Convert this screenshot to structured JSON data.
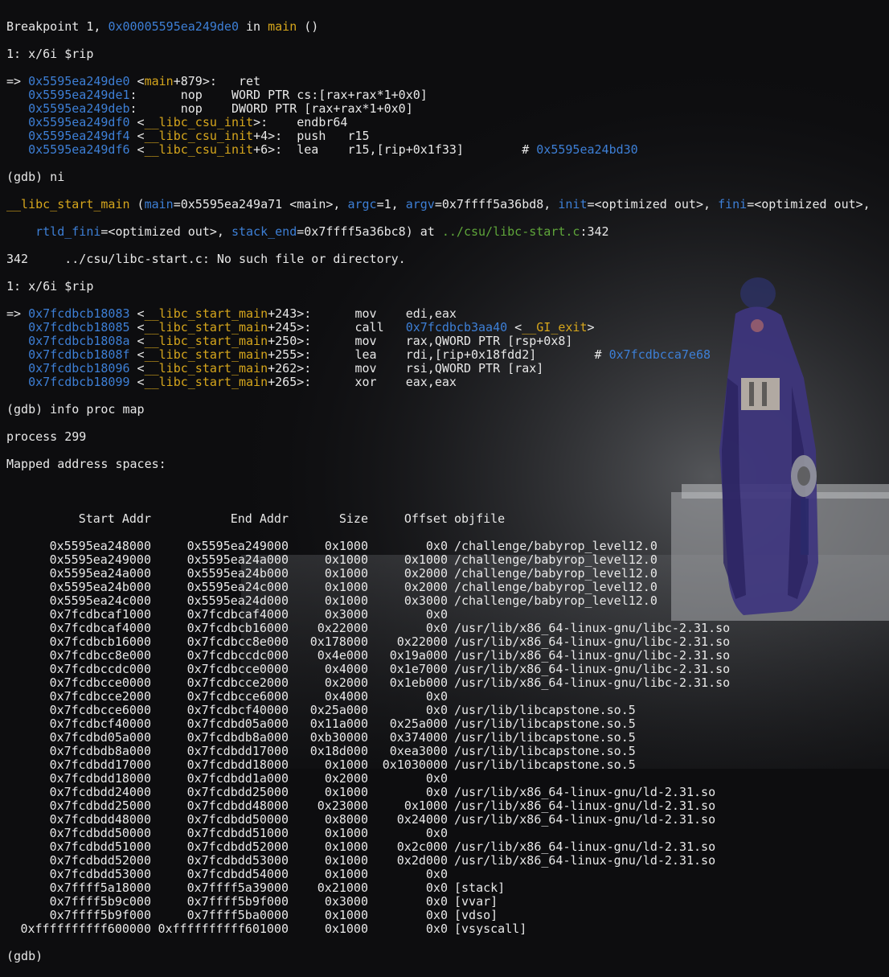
{
  "terminal": {
    "breakpoint": {
      "prefix": "Breakpoint 1, ",
      "address": "0x00005595ea249de0",
      "mid": " in ",
      "func": "main",
      "suffix": " ()"
    },
    "disp1_header": "1: x/6i $rip",
    "block1": [
      {
        "marker": "=> ",
        "addr": "0x5595ea249de0",
        "sym": "main",
        "off": "+879",
        "instr": ":   ret"
      },
      {
        "marker": "   ",
        "addr": "0x5595ea249de1",
        "sym": "",
        "off": "",
        "instr": ":      nop    WORD PTR cs:[rax+rax*1+0x0]"
      },
      {
        "marker": "   ",
        "addr": "0x5595ea249deb",
        "sym": "",
        "off": "",
        "instr": ":      nop    DWORD PTR [rax+rax*1+0x0]"
      },
      {
        "marker": "   ",
        "addr": "0x5595ea249df0",
        "sym": "__libc_csu_init",
        "off": "",
        "instr": ":    endbr64"
      },
      {
        "marker": "   ",
        "addr": "0x5595ea249df4",
        "sym": "__libc_csu_init",
        "off": "+4",
        "instr": ":  push   r15"
      },
      {
        "marker": "   ",
        "addr": "0x5595ea249df6",
        "sym": "__libc_csu_init",
        "off": "+6",
        "instr": ":  lea    r15,[rip+0x1f33]        # ",
        "comment_addr": "0x5595ea24bd30"
      }
    ],
    "cmd_ni": "(gdb) ni",
    "frame": {
      "func": "__libc_start_main",
      "arg_main_name": "main",
      "arg_main_val": "=0x5595ea249a71 <main>, ",
      "argc_name": "argc",
      "argc_val": "=1, ",
      "argv_name": "argv",
      "argv_val": "=0x7ffff5a36bd8, ",
      "init_name": "init",
      "init_val": "=<optimized out>, ",
      "fini_name": "fini",
      "fini_val": "=<optimized out>,",
      "rtld_name": "rtld_fini",
      "rtld_val": "=<optimized out>, ",
      "stack_name": "stack_end",
      "stack_val": "=0x7ffff5a36bc8) at ",
      "file": "../csu/libc-start.c",
      "line_suffix": ":342"
    },
    "nofile_line": "342     ../csu/libc-start.c: No such file or directory.",
    "disp2_header": "1: x/6i $rip",
    "block2": [
      {
        "marker": "=> ",
        "addr": "0x7fcdbcb18083",
        "sym": "__libc_start_main",
        "off": "+243",
        "instr": ">:      mov    edi,eax"
      },
      {
        "marker": "   ",
        "addr": "0x7fcdbcb18085",
        "sym": "__libc_start_main",
        "off": "+245",
        "instr": ">:      call   ",
        "call_addr": "0x7fcdbcb3aa40",
        "call_sym": "__GI_exit"
      },
      {
        "marker": "   ",
        "addr": "0x7fcdbcb1808a",
        "sym": "__libc_start_main",
        "off": "+250",
        "instr": ">:      mov    rax,QWORD PTR [rsp+0x8]"
      },
      {
        "marker": "   ",
        "addr": "0x7fcdbcb1808f",
        "sym": "__libc_start_main",
        "off": "+255",
        "instr": ">:      lea    rdi,[rip+0x18fdd2]        # ",
        "comment_addr": "0x7fcdbcca7e68"
      },
      {
        "marker": "   ",
        "addr": "0x7fcdbcb18096",
        "sym": "__libc_start_main",
        "off": "+262",
        "instr": ">:      mov    rsi,QWORD PTR [rax]"
      },
      {
        "marker": "   ",
        "addr": "0x7fcdbcb18099",
        "sym": "__libc_start_main",
        "off": "+265",
        "instr": ">:      xor    eax,eax"
      }
    ],
    "cmd_info": "(gdb) info proc map",
    "process_line": "process 299",
    "mapped_header": "Mapped address spaces:",
    "map_columns": [
      "Start Addr",
      "End Addr",
      "Size",
      "Offset",
      "objfile"
    ],
    "map_rows": [
      [
        "0x5595ea248000",
        "0x5595ea249000",
        "0x1000",
        "0x0",
        "/challenge/babyrop_level12.0"
      ],
      [
        "0x5595ea249000",
        "0x5595ea24a000",
        "0x1000",
        "0x1000",
        "/challenge/babyrop_level12.0"
      ],
      [
        "0x5595ea24a000",
        "0x5595ea24b000",
        "0x1000",
        "0x2000",
        "/challenge/babyrop_level12.0"
      ],
      [
        "0x5595ea24b000",
        "0x5595ea24c000",
        "0x1000",
        "0x2000",
        "/challenge/babyrop_level12.0"
      ],
      [
        "0x5595ea24c000",
        "0x5595ea24d000",
        "0x1000",
        "0x3000",
        "/challenge/babyrop_level12.0"
      ],
      [
        "0x7fcdbcaf1000",
        "0x7fcdbcaf4000",
        "0x3000",
        "0x0",
        ""
      ],
      [
        "0x7fcdbcaf4000",
        "0x7fcdbcb16000",
        "0x22000",
        "0x0",
        "/usr/lib/x86_64-linux-gnu/libc-2.31.so"
      ],
      [
        "0x7fcdbcb16000",
        "0x7fcdbcc8e000",
        "0x178000",
        "0x22000",
        "/usr/lib/x86_64-linux-gnu/libc-2.31.so"
      ],
      [
        "0x7fcdbcc8e000",
        "0x7fcdbccdc000",
        "0x4e000",
        "0x19a000",
        "/usr/lib/x86_64-linux-gnu/libc-2.31.so"
      ],
      [
        "0x7fcdbccdc000",
        "0x7fcdbcce0000",
        "0x4000",
        "0x1e7000",
        "/usr/lib/x86_64-linux-gnu/libc-2.31.so"
      ],
      [
        "0x7fcdbcce0000",
        "0x7fcdbcce2000",
        "0x2000",
        "0x1eb000",
        "/usr/lib/x86_64-linux-gnu/libc-2.31.so"
      ],
      [
        "0x7fcdbcce2000",
        "0x7fcdbcce6000",
        "0x4000",
        "0x0",
        ""
      ],
      [
        "0x7fcdbcce6000",
        "0x7fcdbcf40000",
        "0x25a000",
        "0x0",
        "/usr/lib/libcapstone.so.5"
      ],
      [
        "0x7fcdbcf40000",
        "0x7fcdbd05a000",
        "0x11a000",
        "0x25a000",
        "/usr/lib/libcapstone.so.5"
      ],
      [
        "0x7fcdbd05a000",
        "0x7fcdbdb8a000",
        "0xb30000",
        "0x374000",
        "/usr/lib/libcapstone.so.5"
      ],
      [
        "0x7fcdbdb8a000",
        "0x7fcdbdd17000",
        "0x18d000",
        "0xea3000",
        "/usr/lib/libcapstone.so.5"
      ],
      [
        "0x7fcdbdd17000",
        "0x7fcdbdd18000",
        "0x1000",
        "0x1030000",
        "/usr/lib/libcapstone.so.5"
      ],
      [
        "0x7fcdbdd18000",
        "0x7fcdbdd1a000",
        "0x2000",
        "0x0",
        ""
      ],
      [
        "0x7fcdbdd24000",
        "0x7fcdbdd25000",
        "0x1000",
        "0x0",
        "/usr/lib/x86_64-linux-gnu/ld-2.31.so"
      ],
      [
        "0x7fcdbdd25000",
        "0x7fcdbdd48000",
        "0x23000",
        "0x1000",
        "/usr/lib/x86_64-linux-gnu/ld-2.31.so"
      ],
      [
        "0x7fcdbdd48000",
        "0x7fcdbdd50000",
        "0x8000",
        "0x24000",
        "/usr/lib/x86_64-linux-gnu/ld-2.31.so"
      ],
      [
        "0x7fcdbdd50000",
        "0x7fcdbdd51000",
        "0x1000",
        "0x0",
        ""
      ],
      [
        "0x7fcdbdd51000",
        "0x7fcdbdd52000",
        "0x1000",
        "0x2c000",
        "/usr/lib/x86_64-linux-gnu/ld-2.31.so"
      ],
      [
        "0x7fcdbdd52000",
        "0x7fcdbdd53000",
        "0x1000",
        "0x2d000",
        "/usr/lib/x86_64-linux-gnu/ld-2.31.so"
      ],
      [
        "0x7fcdbdd53000",
        "0x7fcdbdd54000",
        "0x1000",
        "0x0",
        ""
      ],
      [
        "0x7ffff5a18000",
        "0x7ffff5a39000",
        "0x21000",
        "0x0",
        "[stack]"
      ],
      [
        "0x7ffff5b9c000",
        "0x7ffff5b9f000",
        "0x3000",
        "0x0",
        "[vvar]"
      ],
      [
        "0x7ffff5b9f000",
        "0x7ffff5ba0000",
        "0x1000",
        "0x0",
        "[vdso]"
      ],
      [
        "0xffffffffff600000",
        "0xffffffffff601000",
        "0x1000",
        "0x0",
        "[vsyscall]"
      ]
    ],
    "final_prompt": "(gdb)"
  },
  "colors": {
    "address": "#3d7fd6",
    "symbol": "#d6a61c",
    "path": "#5fa63a",
    "text": "#e8e8e8",
    "background": "#0d0d0f"
  }
}
